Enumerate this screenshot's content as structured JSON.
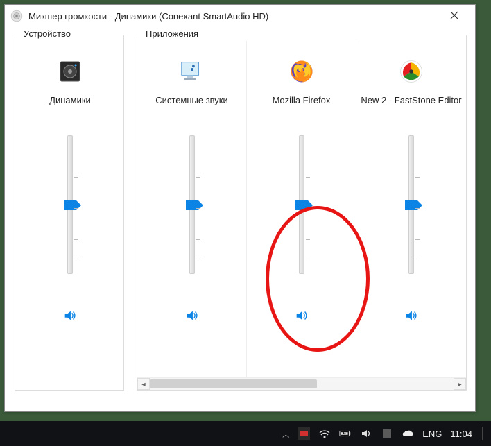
{
  "window": {
    "title": "Микшер громкости - Динамики (Conexant SmartAudio HD)"
  },
  "sections": {
    "device_label": "Устройство",
    "apps_label": "Приложения"
  },
  "channels": {
    "device": {
      "label": "Динамики",
      "level": 50
    },
    "apps": [
      {
        "label": "Системные звуки",
        "level": 50,
        "icon": "system-sounds"
      },
      {
        "label": "Mozilla Firefox",
        "level": 50,
        "icon": "firefox"
      },
      {
        "label": "New 2 - FastStone Editor",
        "level": 50,
        "icon": "faststone"
      }
    ]
  },
  "taskbar": {
    "lang": "ENG",
    "time": "11:04"
  }
}
